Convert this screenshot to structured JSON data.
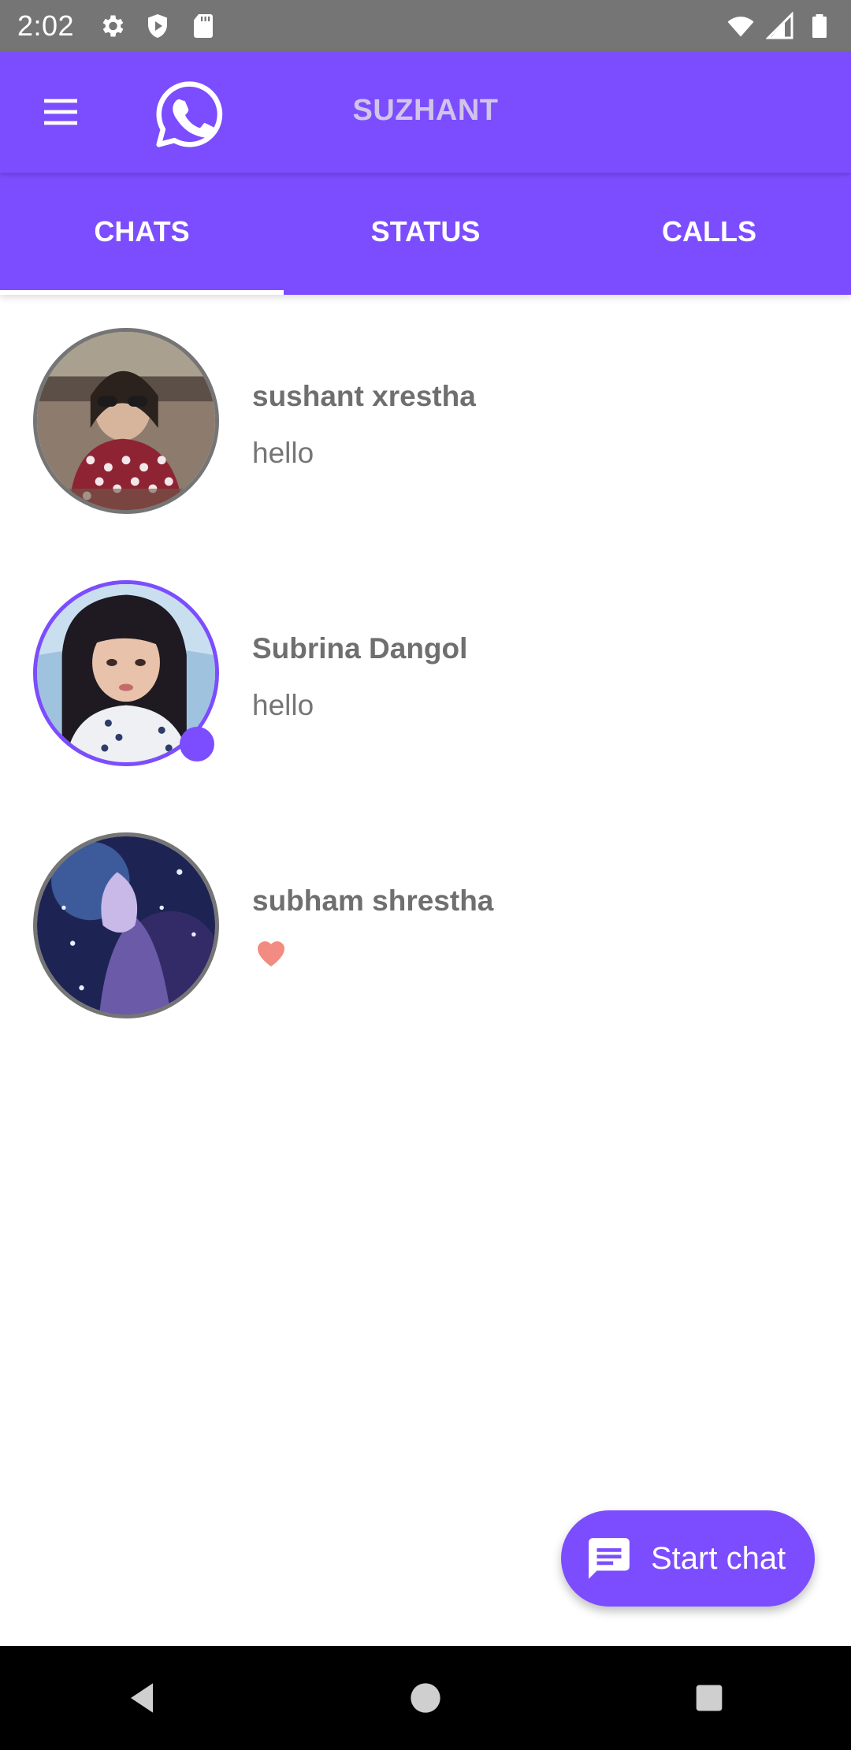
{
  "status_bar": {
    "time": "2:02",
    "left_icons": [
      "settings-icon",
      "shield-icon",
      "sd-card-icon"
    ],
    "right_icons": [
      "wifi-icon",
      "signal-icon",
      "battery-icon"
    ]
  },
  "app_bar": {
    "title": "SUZHANT",
    "menu_icon": "hamburger-menu-icon",
    "logo_icon": "whatsapp-logo-icon"
  },
  "tabs": [
    {
      "label": "CHATS",
      "active": true
    },
    {
      "label": "STATUS",
      "active": false
    },
    {
      "label": "CALLS",
      "active": false
    }
  ],
  "chats": [
    {
      "name": "sushant xrestha",
      "preview": "hello",
      "online": false
    },
    {
      "name": "Subrina Dangol",
      "preview": "hello",
      "online": true
    },
    {
      "name": "subham shrestha",
      "preview": "",
      "preview_icon": "heart-emoji-icon",
      "online": false
    }
  ],
  "fab": {
    "label": "Start chat",
    "icon": "message-icon"
  },
  "colors": {
    "primary": "#7c4dff",
    "title_text": "#d1c4e9",
    "status_bar": "#757575",
    "name_text": "#6f6f6f"
  },
  "nav_bar": {
    "buttons": [
      "back-icon",
      "home-icon",
      "recents-icon"
    ]
  }
}
